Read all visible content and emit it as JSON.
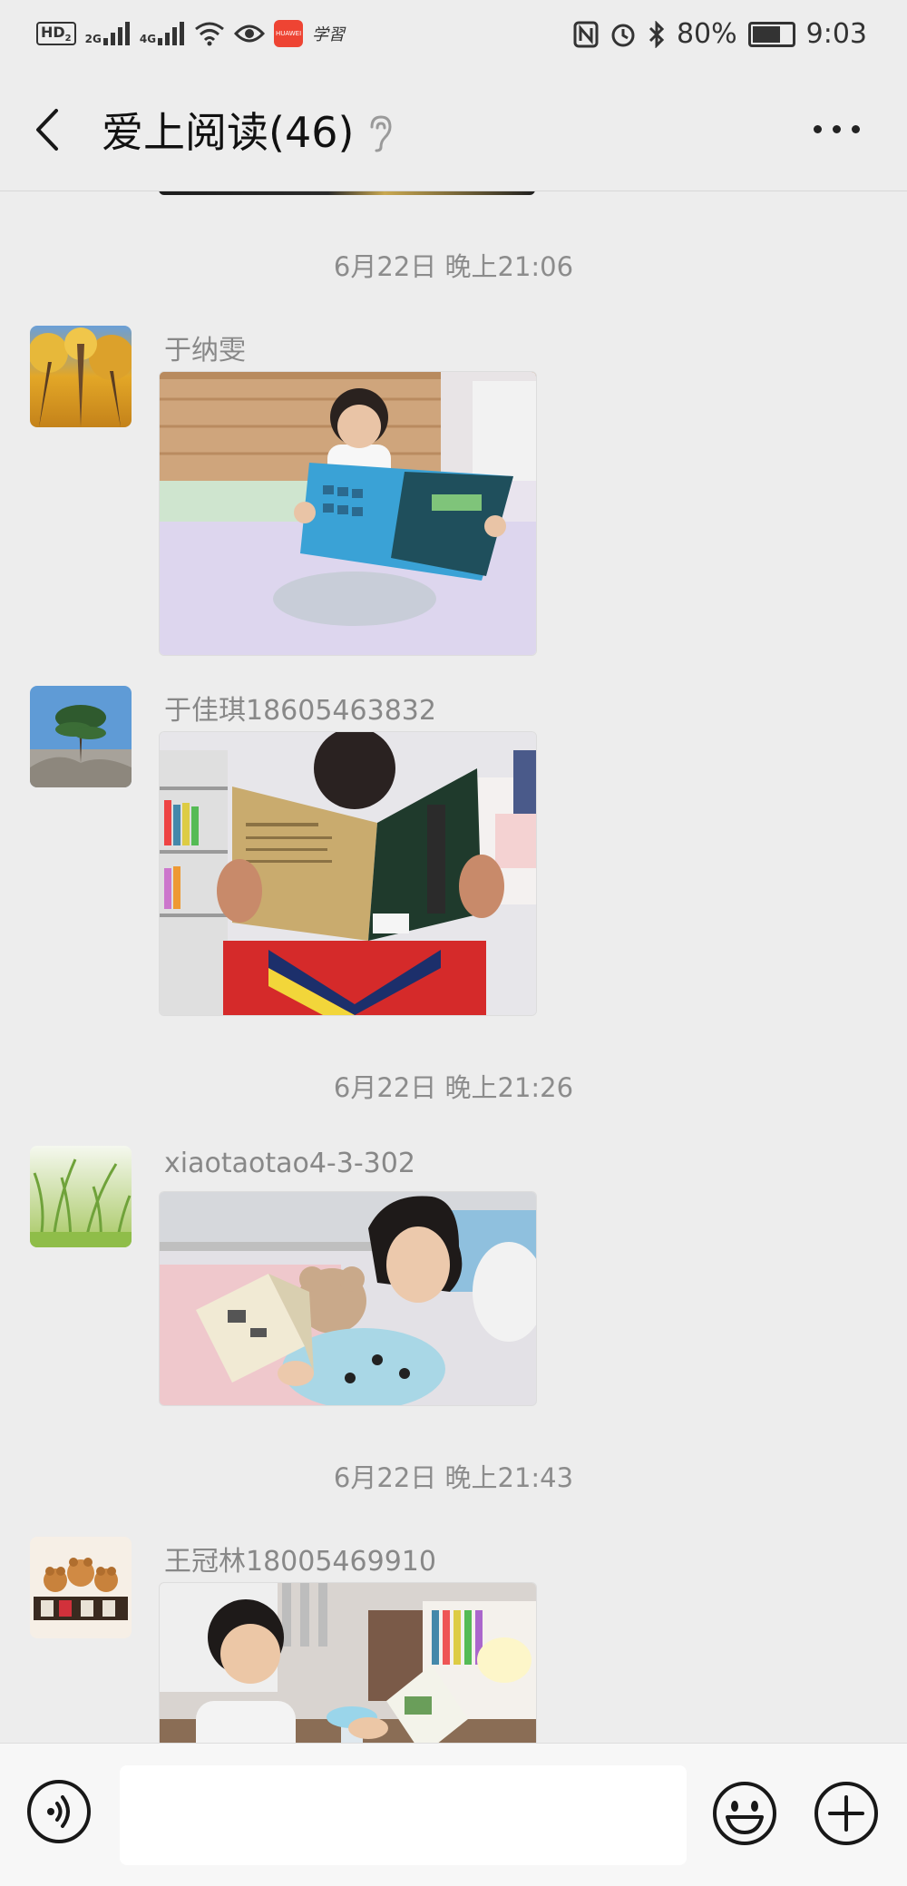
{
  "statusbar": {
    "signal_1": "2G",
    "signal_2": "4G",
    "app_label": "学習",
    "huawei_badge": "HUAWEI",
    "battery": "80%",
    "battery_level": 0.8,
    "time": "9:03",
    "hd": "HD",
    "hd_sub": "2"
  },
  "header": {
    "title": "爱上阅读(46)"
  },
  "messages": [
    {
      "timestamp": "6月22日 晚上21:06",
      "sender": "于纳雯"
    },
    {
      "sender": "于佳琪18605463832"
    },
    {
      "timestamp": "6月22日 晚上21:26",
      "sender": "xiaotaotao4-3-302"
    },
    {
      "timestamp": "6月22日 晚上21:43",
      "sender": "王冠林18005469910"
    }
  ],
  "icons": {
    "back": "chevron-left-icon",
    "ear": "ear-icon",
    "more": "more-horizontal-icon",
    "voice": "voice-icon",
    "emoji": "emoji-icon",
    "add": "plus-icon"
  },
  "input": {
    "value": ""
  }
}
